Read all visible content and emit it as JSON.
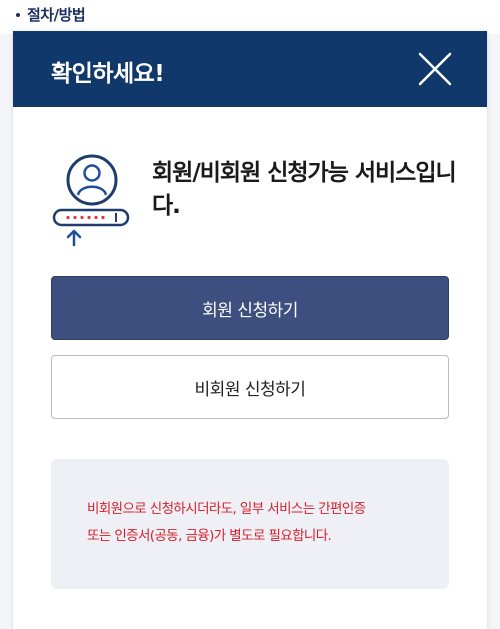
{
  "section": {
    "label": "절차/방법"
  },
  "modal": {
    "title": "확인하세요!",
    "intro_text": "회원/비회원 신청가능 서비스입니다.",
    "member_button_label": "회원 신청하기",
    "guest_button_label": "비회원 신청하기",
    "notice_line1": "비회원으로 신청하시더라도, 일부 서비스는 간편인증",
    "notice_line2": "또는 인증서(공동, 금융)가 별도로 필요합니다."
  },
  "colors": {
    "header_bg": "#11386b",
    "primary_button_bg": "#3d4f7e",
    "notice_text": "#d81e2c",
    "notice_bg": "#eef0f6",
    "icon_blue": "#1f4e9a"
  },
  "icons": {
    "close": "close-icon",
    "intro": "user-login-icon"
  }
}
